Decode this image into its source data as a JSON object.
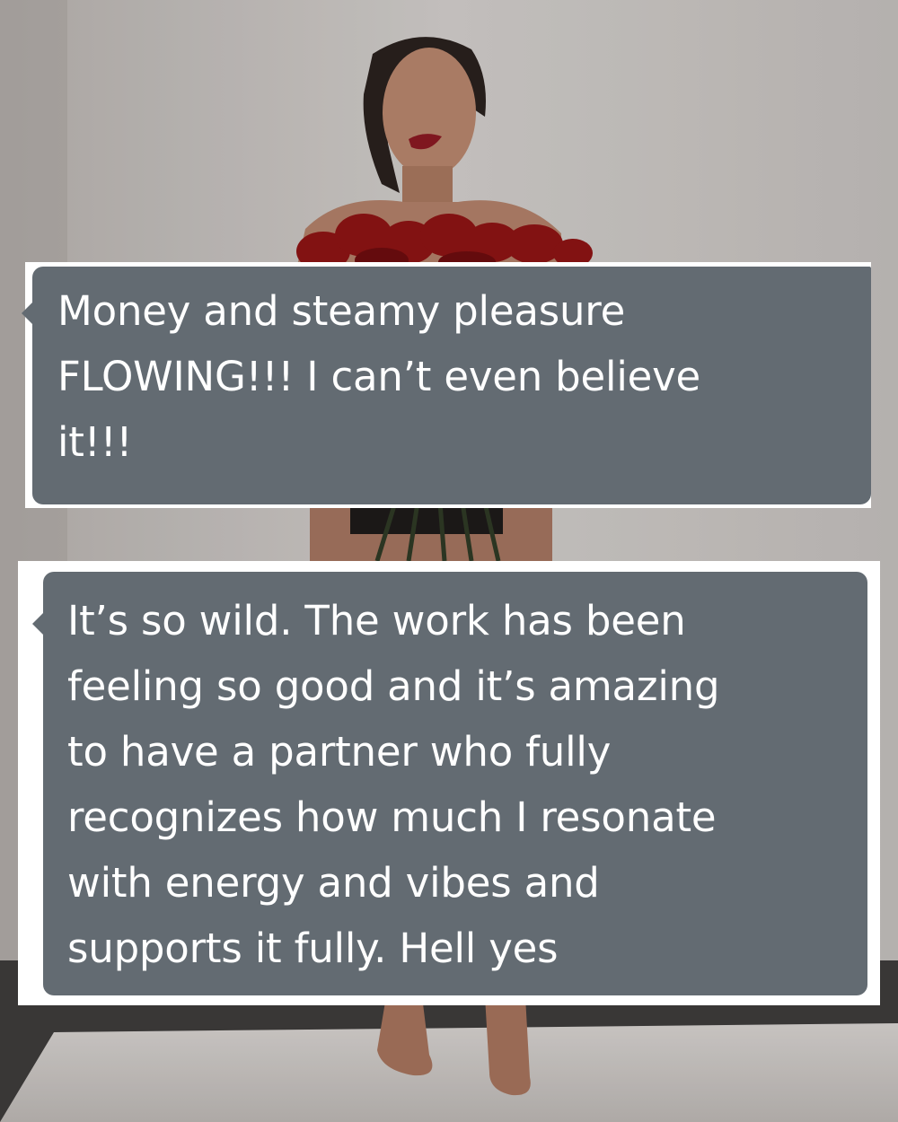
{
  "messages": [
    {
      "text": "Money and steamy pleasure\nFLOWING!!! I can’t even believe\nit!!!"
    },
    {
      "text": "It’s so wild. The work has been\nfeeling so good and it’s amazing\nto have a partner who fully\nrecognizes how much I resonate\nwith energy and vibes and\nsupports it fully. Hell yes"
    }
  ],
  "colors": {
    "bubble": "#636b72",
    "bubble_text": "#ffffff",
    "card": "#ffffff",
    "wall": "#c9c5c2",
    "roses": "#8e1414"
  }
}
